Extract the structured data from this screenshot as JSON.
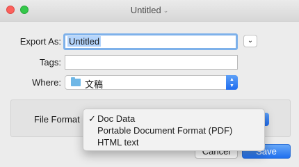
{
  "window": {
    "title": "Untitled"
  },
  "export_as": {
    "label": "Export As:",
    "value": "Untitled"
  },
  "tags": {
    "label": "Tags:",
    "value": ""
  },
  "where": {
    "label": "Where:",
    "value": "文稿"
  },
  "file_format": {
    "label": "File Format",
    "selected": "Doc Data",
    "options": [
      "Doc Data",
      "Portable Document Format (PDF)",
      "HTML text"
    ]
  },
  "buttons": {
    "cancel": "Cancel",
    "save": "Save"
  }
}
